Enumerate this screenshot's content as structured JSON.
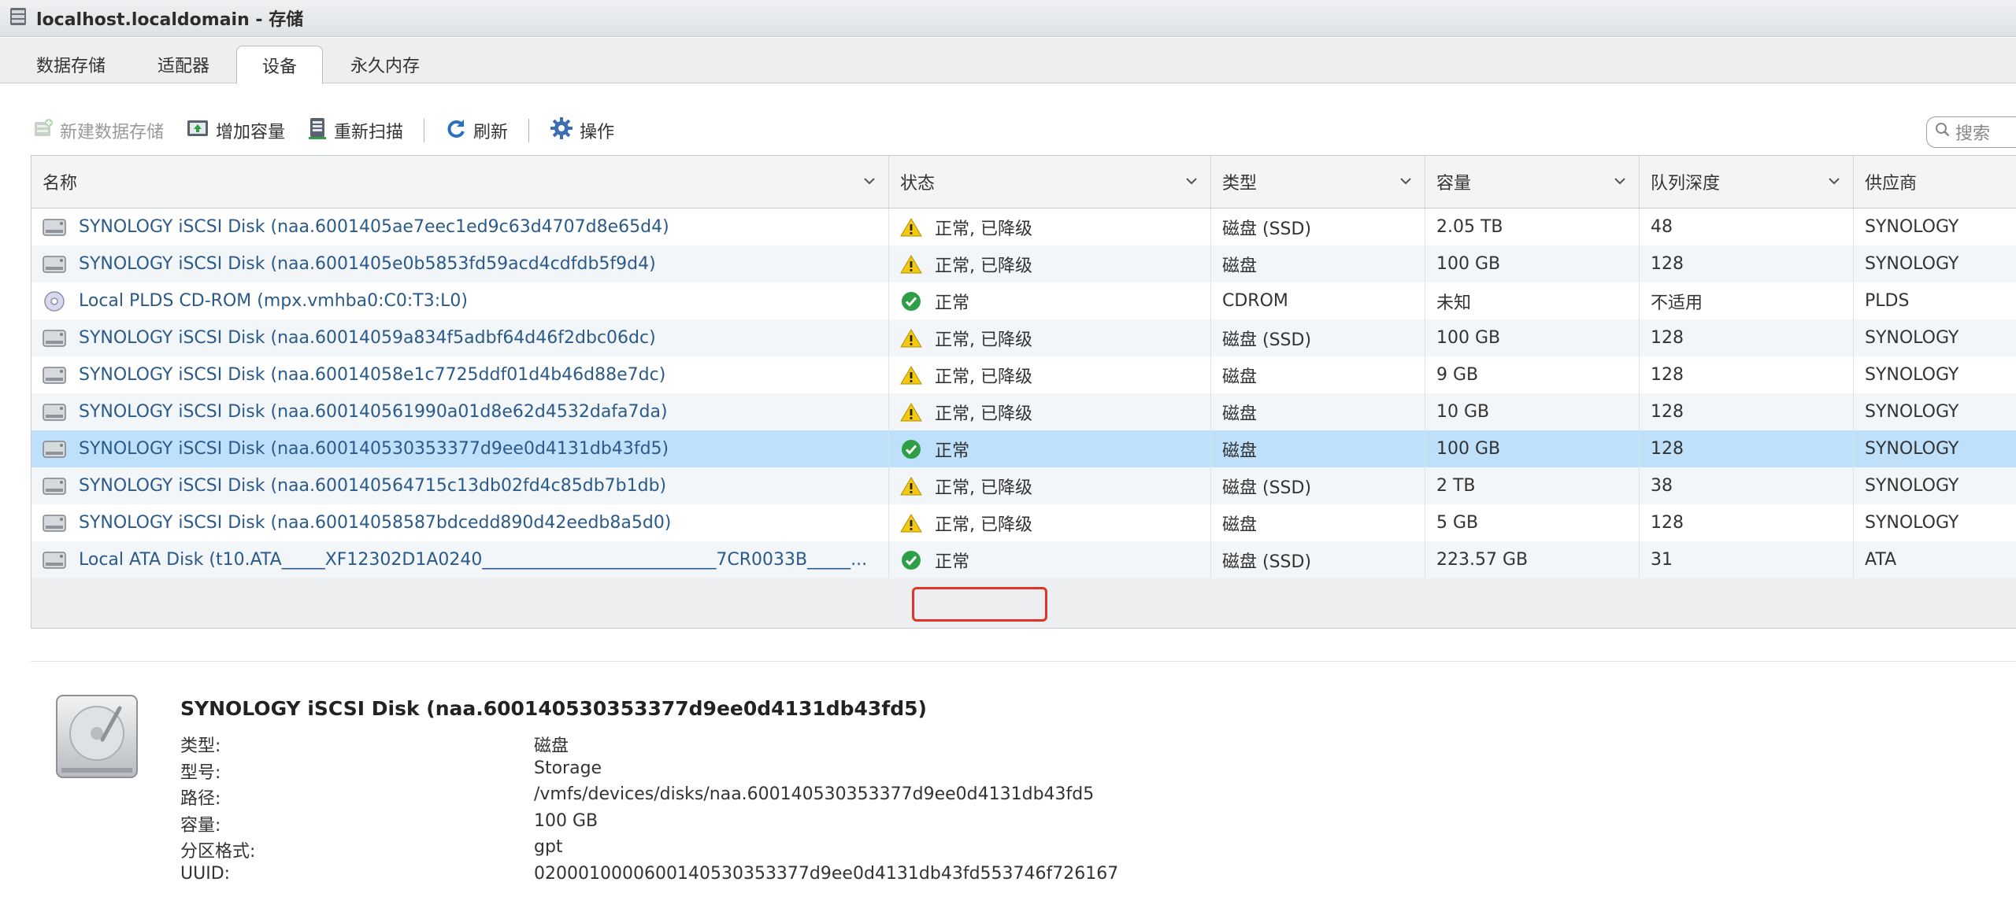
{
  "window": {
    "title": "localhost.localdomain - 存储"
  },
  "tabs": [
    {
      "label": "数据存储",
      "active": false
    },
    {
      "label": "适配器",
      "active": false
    },
    {
      "label": "设备",
      "active": true
    },
    {
      "label": "永久内存",
      "active": false
    }
  ],
  "toolbar": {
    "new_datastore": "新建数据存储",
    "increase_capacity": "增加容量",
    "rescan": "重新扫描",
    "refresh": "刷新",
    "actions": "操作"
  },
  "search": {
    "placeholder": "搜索"
  },
  "table": {
    "columns": [
      "名称",
      "状态",
      "类型",
      "容量",
      "队列深度",
      "供应商"
    ],
    "rows": [
      {
        "icon": "disk-icon",
        "name": "SYNOLOGY iSCSI Disk (naa.6001405ae7eec1ed9c63d4707d8e65d4)",
        "status": "正常, 已降级",
        "status_kind": "warning",
        "type": "磁盘 (SSD)",
        "capacity": "2.05 TB",
        "queue": "48",
        "vendor": "SYNOLOGY"
      },
      {
        "icon": "disk-icon",
        "name": "SYNOLOGY iSCSI Disk (naa.6001405e0b5853fd59acd4cdfdb5f9d4)",
        "status": "正常, 已降级",
        "status_kind": "warning",
        "type": "磁盘",
        "capacity": "100 GB",
        "queue": "128",
        "vendor": "SYNOLOGY"
      },
      {
        "icon": "cdrom-icon",
        "name": "Local PLDS CD-ROM (mpx.vmhba0:C0:T3:L0)",
        "status": "正常",
        "status_kind": "ok",
        "type": "CDROM",
        "capacity": "未知",
        "queue": "不适用",
        "vendor": "PLDS"
      },
      {
        "icon": "disk-icon",
        "name": "SYNOLOGY iSCSI Disk (naa.60014059a834f5adbf64d46f2dbc06dc)",
        "status": "正常, 已降级",
        "status_kind": "warning",
        "type": "磁盘 (SSD)",
        "capacity": "100 GB",
        "queue": "128",
        "vendor": "SYNOLOGY"
      },
      {
        "icon": "disk-icon",
        "name": "SYNOLOGY iSCSI Disk (naa.60014058e1c7725ddf01d4b46d88e7dc)",
        "status": "正常, 已降级",
        "status_kind": "warning",
        "type": "磁盘",
        "capacity": "9 GB",
        "queue": "128",
        "vendor": "SYNOLOGY"
      },
      {
        "icon": "disk-icon",
        "name": "SYNOLOGY iSCSI Disk (naa.600140561990a01d8e62d4532dafa7da)",
        "status": "正常, 已降级",
        "status_kind": "warning",
        "type": "磁盘",
        "capacity": "10 GB",
        "queue": "128",
        "vendor": "SYNOLOGY"
      },
      {
        "icon": "disk-icon",
        "name": "SYNOLOGY iSCSI Disk (naa.600140530353377d9ee0d4131db43fd5)",
        "status": "正常",
        "status_kind": "ok",
        "type": "磁盘",
        "capacity": "100 GB",
        "queue": "128",
        "vendor": "SYNOLOGY",
        "selected": true
      },
      {
        "icon": "disk-icon",
        "name": "SYNOLOGY iSCSI Disk (naa.600140564715c13db02fd4c85db7b1db)",
        "status": "正常, 已降级",
        "status_kind": "warning",
        "type": "磁盘 (SSD)",
        "capacity": "2 TB",
        "queue": "38",
        "vendor": "SYNOLOGY"
      },
      {
        "icon": "disk-icon",
        "name": "SYNOLOGY iSCSI Disk (naa.60014058587bdcedd890d42eedb8a5d0)",
        "status": "正常, 已降级",
        "status_kind": "warning",
        "type": "磁盘",
        "capacity": "5 GB",
        "queue": "128",
        "vendor": "SYNOLOGY"
      },
      {
        "icon": "disk-icon",
        "name": "Local ATA Disk (t10.ATA_____XF12302D1A0240___________________________7CR0033B_____...",
        "status": "正常",
        "status_kind": "ok",
        "type": "磁盘 (SSD)",
        "capacity": "223.57 GB",
        "queue": "31",
        "vendor": "ATA"
      }
    ]
  },
  "detail": {
    "title": "SYNOLOGY iSCSI Disk (naa.600140530353377d9ee0d4131db43fd5)",
    "fields": [
      {
        "label": "类型:",
        "value": "磁盘"
      },
      {
        "label": "型号:",
        "value": "Storage"
      },
      {
        "label": "路径:",
        "value": "/vmfs/devices/disks/naa.600140530353377d9ee0d4131db43fd5"
      },
      {
        "label": "容量:",
        "value": "100 GB"
      },
      {
        "label": "分区格式:",
        "value": "gpt"
      },
      {
        "label": "UUID:",
        "value": "0200010000600140530353377d9ee0d4131db43fd553746f726167"
      }
    ]
  },
  "colors": {
    "link": "#2a5a8a",
    "selected_row": "#bfe0fb",
    "highlight_border": "#e2332b",
    "ok": "#2e9e47",
    "warning": "#f2c811"
  }
}
